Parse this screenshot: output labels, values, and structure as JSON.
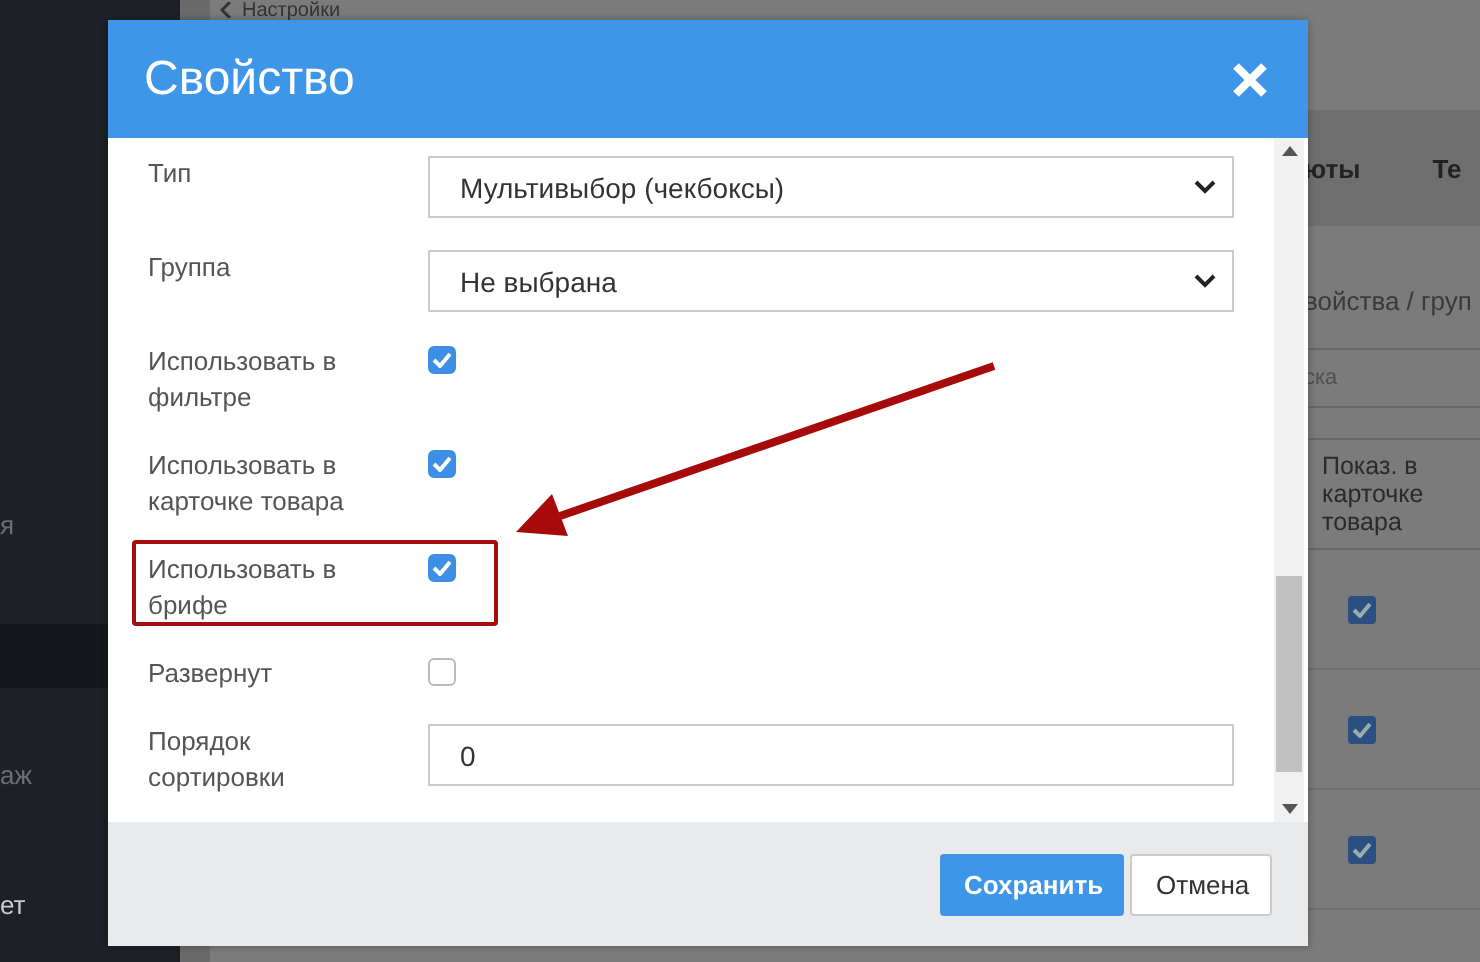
{
  "sidebar": {
    "items": [
      {
        "label": "я"
      },
      {
        "label": "аж"
      },
      {
        "label": "ет"
      }
    ]
  },
  "breadcrumb": "Настройки",
  "background": {
    "tabs": [
      "юты",
      "Те"
    ],
    "path": "войства / груп",
    "search_placeholder": "ска",
    "column_header": "Показ. в карточке товара",
    "row_checks": [
      true,
      true,
      true
    ]
  },
  "dialog": {
    "title": "Свойство",
    "fields": [
      {
        "kind": "select",
        "label": "Тип",
        "value": "Мультивыбор (чекбоксы)",
        "highlighted": false
      },
      {
        "kind": "select",
        "label": "Группа",
        "value": "Не выбрана",
        "highlighted": false
      },
      {
        "kind": "checkbox",
        "label": "Использовать в фильтре",
        "checked": true,
        "highlighted": false
      },
      {
        "kind": "checkbox",
        "label": "Использовать в карточке товара",
        "checked": true,
        "highlighted": false
      },
      {
        "kind": "checkbox",
        "label": "Использовать в брифе",
        "checked": true,
        "highlighted": true
      },
      {
        "kind": "checkbox",
        "label": "Развернут",
        "checked": false,
        "highlighted": false
      },
      {
        "kind": "text",
        "label": "Порядок сортировки",
        "value": "0",
        "highlighted": false
      }
    ],
    "buttons": [
      {
        "label": "Сохранить",
        "kind": "primary"
      },
      {
        "label": "Отмена",
        "kind": "secondary"
      }
    ]
  }
}
